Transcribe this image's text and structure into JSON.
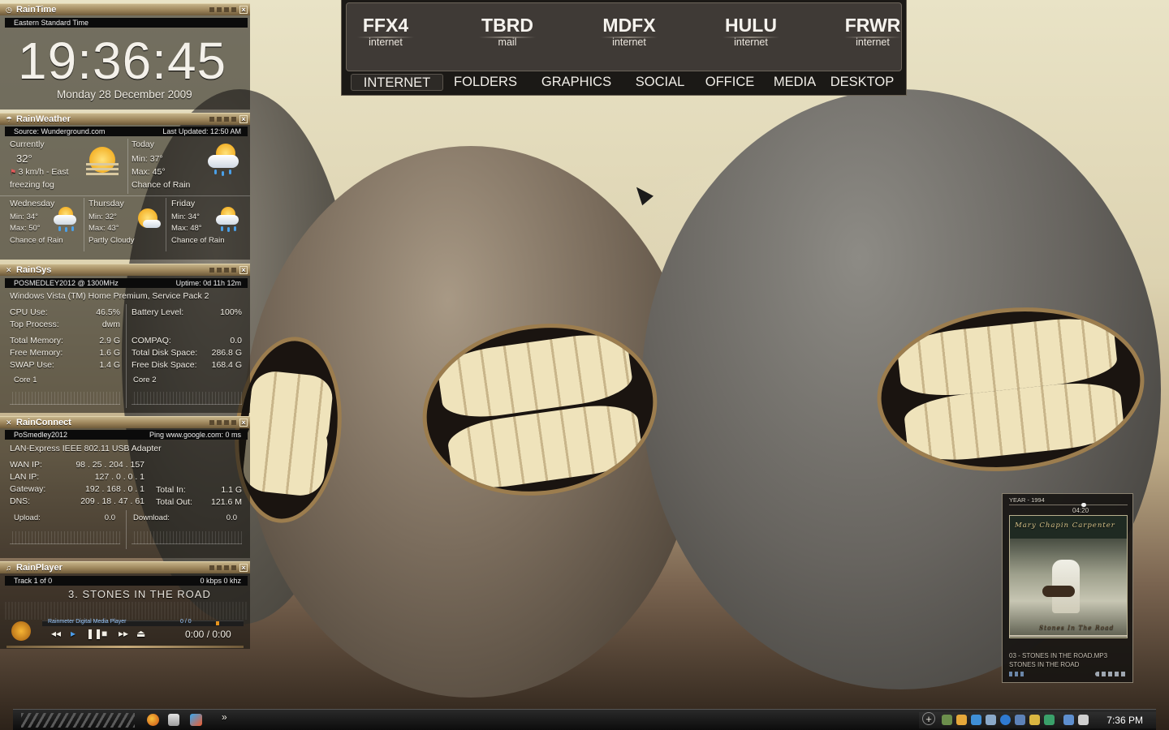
{
  "rain_time": {
    "title": "RainTime",
    "timezone": "Eastern Standard Time",
    "time": "19:36:45",
    "date": "Monday 28 December 2009"
  },
  "rain_weather": {
    "title": "RainWeather",
    "source": "Source: Wunderground.com",
    "last_updated": "Last Updated: 12:50 AM",
    "current": {
      "label": "Currently",
      "temp": "32°",
      "wind": "3 km/h - East",
      "condition": "freezing fog"
    },
    "today": {
      "label": "Today",
      "min": "Min:  37°",
      "max": "Max: 45°",
      "condition": "Chance of Rain"
    },
    "forecast": [
      {
        "day": "Wednesday",
        "min": "Min: 34°",
        "max": "Max: 50°",
        "condition": "Chance of Rain"
      },
      {
        "day": "Thursday",
        "min": "Min: 32°",
        "max": "Max: 43°",
        "condition": "Partly Cloudy"
      },
      {
        "day": "Friday",
        "min": "Min: 34°",
        "max": "Max: 48°",
        "condition": "Chance of Rain"
      }
    ]
  },
  "rain_sys": {
    "title": "RainSys",
    "host": "POSMEDLEY2012 @ 1300MHz",
    "uptime": "Uptime: 0d 11h 12m",
    "os": "Windows Vista (TM) Home Premium, Service Pack 2",
    "left": [
      {
        "label": "CPU Use:",
        "value": "46.5%"
      },
      {
        "label": "Top Process:",
        "value": "dwm"
      },
      {
        "label": "Total Memory:",
        "value": "2.9 G"
      },
      {
        "label": "Free Memory:",
        "value": "1.6 G"
      },
      {
        "label": "SWAP Use:",
        "value": "1.4 G"
      }
    ],
    "right": [
      {
        "label": "Battery Level:",
        "value": "100%"
      },
      {
        "label": "COMPAQ:",
        "value": "0.0"
      },
      {
        "label": "Total Disk Space:",
        "value": "286.8 G"
      },
      {
        "label": "Free Disk Space:",
        "value": "168.4 G"
      }
    ],
    "core1": "Core 1",
    "core2": "Core 2"
  },
  "rain_connect": {
    "title": "RainConnect",
    "host": "PoSmedley2012",
    "ping": "Ping www.google.com: 0 ms",
    "adapter": "LAN-Express IEEE 802.11 USB Adapter",
    "rows": [
      {
        "label": "WAN IP:",
        "value": "98 . 25 . 204 . 157"
      },
      {
        "label": "LAN IP:",
        "value": "127 . 0 . 0 . 1"
      },
      {
        "label": "Gateway:",
        "value": "192 . 168 . 0 . 1"
      },
      {
        "label": "DNS:",
        "value": "209 . 18 . 47 . 61"
      }
    ],
    "totals": [
      {
        "label": "Total In:",
        "value": "1.1 G"
      },
      {
        "label": "Total Out:",
        "value": "121.6 M"
      }
    ],
    "upload": {
      "label": "Upload:",
      "value": "0.0"
    },
    "download": {
      "label": "Download:",
      "value": "0.0"
    }
  },
  "rain_player": {
    "title": "RainPlayer",
    "track_index": "Track 1 of 0",
    "bitrate": "0 kbps  0 khz",
    "track_name": "3. STONES IN THE ROAD",
    "player_name": "Rainmeter Digital Media Player",
    "progress_label": "0 / 0",
    "time": "0:00 / 0:00"
  },
  "launcher": {
    "apps": [
      {
        "code": "FFX4",
        "kind": "internet"
      },
      {
        "code": "TBRD",
        "kind": "mail"
      },
      {
        "code": "MDFX",
        "kind": "internet"
      },
      {
        "code": "HULU",
        "kind": "internet"
      },
      {
        "code": "FRWR",
        "kind": "internet"
      }
    ],
    "tabs": [
      "INTERNET",
      "FOLDERS",
      "GRAPHICS",
      "SOCIAL",
      "OFFICE",
      "MEDIA",
      "DESKTOP"
    ],
    "active_tab": "INTERNET"
  },
  "media_widget": {
    "year": "YEAR - 1994",
    "position": "04:20",
    "artist": "Mary Chapin Carpenter",
    "album_script": "Stones In The Road",
    "file": "03 - STONES IN THE ROAD.MP3",
    "album": "STONES IN THE ROAD"
  },
  "taskbar": {
    "clock": "7:36 PM",
    "more": "»",
    "tray_add": "+"
  },
  "colors": {
    "panel_title": "#9c845a",
    "accent_orange": "#e8941c",
    "taskbar": "#0c0c0c"
  }
}
